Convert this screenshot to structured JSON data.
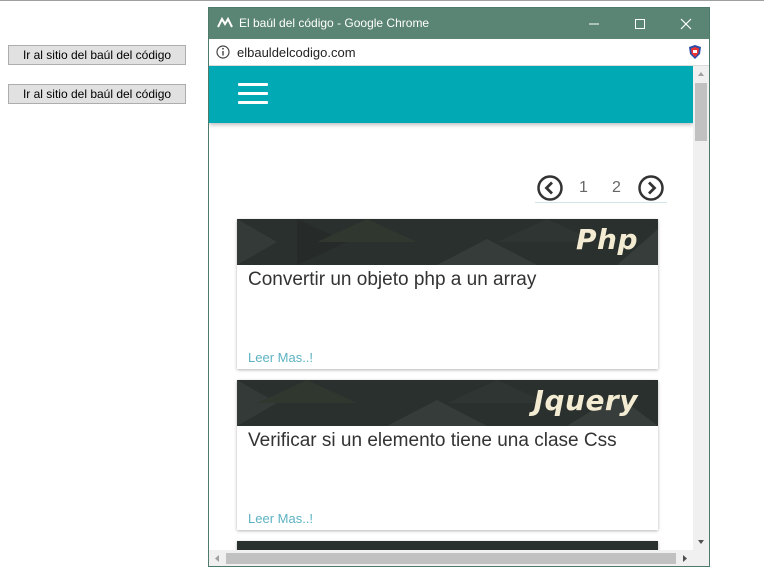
{
  "host": {
    "button_1_label": "Ir al sitio del baúl del código",
    "button_2_label": "Ir al sitio del baúl del código"
  },
  "window": {
    "title": "El baúl del código - Google Chrome",
    "url": "elbauldelcodigo.com",
    "titlebar_color": "#5a8473"
  },
  "site": {
    "navbar_color": "#00a9b4",
    "pagination": {
      "pages": [
        "1",
        "2"
      ]
    },
    "cards": [
      {
        "tag": "Php",
        "title": "Convertir un objeto php a un array",
        "link": "Leer Mas..!"
      },
      {
        "tag": "Jquery",
        "title": "Verificar si un elemento tiene una clase Css",
        "link": "Leer Mas..!"
      }
    ]
  },
  "icons": {
    "app": "vscode-like-logo-icon",
    "info": "info-icon",
    "extension": "shield-extension-icon",
    "menu": "hamburger-menu-icon",
    "prev": "chevron-left-circle-icon",
    "next": "chevron-right-circle-icon"
  }
}
